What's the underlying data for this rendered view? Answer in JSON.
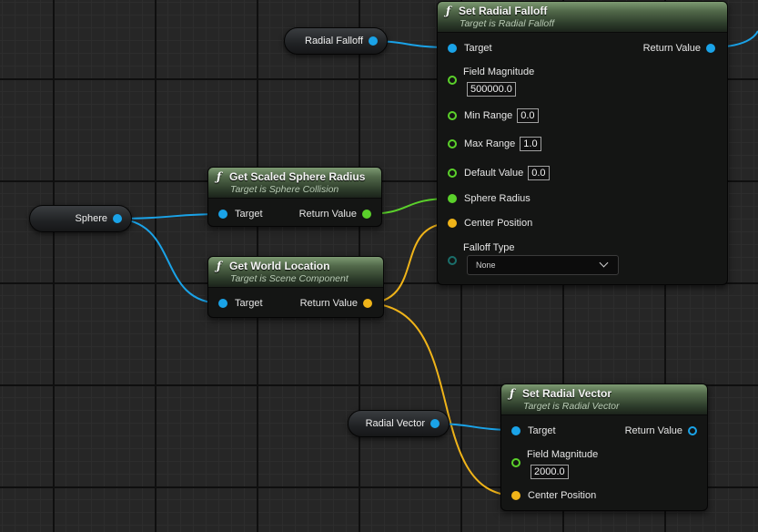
{
  "variables": {
    "radial_falloff": "Radial Falloff",
    "sphere": "Sphere",
    "radial_vector": "Radial Vector"
  },
  "set_radial_falloff": {
    "title": "Set Radial Falloff",
    "subtitle": "Target is Radial Falloff",
    "target": "Target",
    "return_value": "Return Value",
    "field_magnitude_label": "Field Magnitude",
    "field_magnitude_value": "500000.0",
    "min_range_label": "Min Range",
    "min_range_value": "0.0",
    "max_range_label": "Max Range",
    "max_range_value": "1.0",
    "default_value_label": "Default Value",
    "default_value_value": "0.0",
    "sphere_radius": "Sphere Radius",
    "center_position": "Center Position",
    "falloff_type_label": "Falloff Type",
    "falloff_type_value": "None"
  },
  "get_scaled_sphere_radius": {
    "title": "Get Scaled Sphere Radius",
    "subtitle": "Target is Sphere Collision",
    "target": "Target",
    "return_value": "Return Value"
  },
  "get_world_location": {
    "title": "Get World Location",
    "subtitle": "Target is Scene Component",
    "target": "Target",
    "return_value": "Return Value"
  },
  "set_radial_vector": {
    "title": "Set Radial Vector",
    "subtitle": "Target is Radial Vector",
    "target": "Target",
    "return_value": "Return Value",
    "field_magnitude_label": "Field Magnitude",
    "field_magnitude_value": "2000.0",
    "center_position": "Center Position"
  },
  "colors": {
    "object_pin": "#1aa3e8",
    "float_pin": "#5bd12b",
    "vector_pin": "#f0b419",
    "enum_pin": "#1a6e6a",
    "node_header": "#52694a",
    "background": "#262626"
  },
  "icons": {
    "function": "function-icon",
    "dropdown": "chevron-down-icon"
  }
}
